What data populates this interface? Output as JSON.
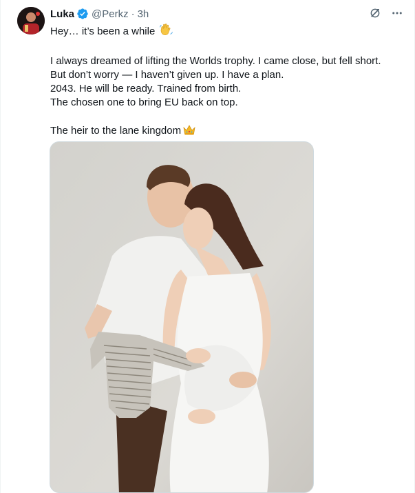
{
  "author": {
    "name": "Luka",
    "handle": "@Perkz",
    "separator": "·",
    "time": "3h",
    "verified": true,
    "avatar_icon": "avatar-photo"
  },
  "actions": {
    "grok_icon": "grok-icon",
    "more_icon": "more-icon"
  },
  "tweet": {
    "line1": "Hey… it’s been a while",
    "line1_emoji": "waving-hand-emoji",
    "line2": "I always dreamed of lifting the Worlds trophy. I came close, but fell short.",
    "line3": "But don’t worry — I haven’t given up. I have a plan.",
    "line4": "2043. He will be ready. Trained from birth.",
    "line5": "The chosen one to bring EU back on top.",
    "line6": "The heir to the lane kingdom",
    "line6_emoji": "crown-emoji"
  },
  "colors": {
    "text": "#0f1419",
    "secondary": "#536471",
    "verified": "#1d9bf0",
    "border": "#cfd9de"
  }
}
